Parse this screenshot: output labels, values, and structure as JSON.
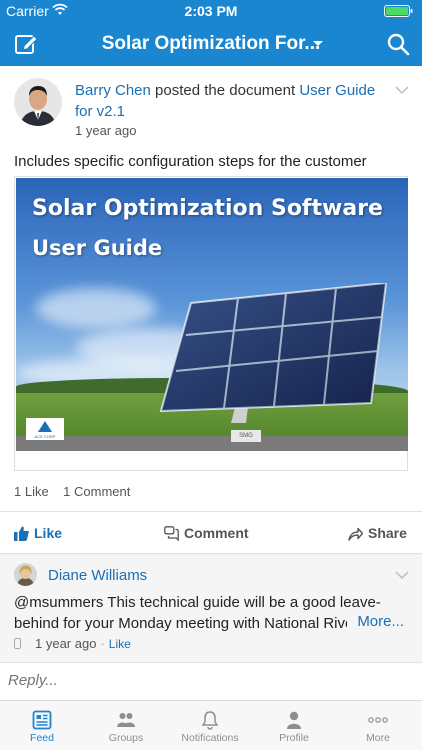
{
  "status_bar": {
    "carrier": "Carrier",
    "time": "2:03 PM"
  },
  "nav": {
    "title": "Solar Optimization For..."
  },
  "post": {
    "author": "Barry Chen",
    "action": "posted the document",
    "document": "User Guide for v2.1",
    "time": "1 year ago",
    "body": "Includes specific configuration steps for the customer",
    "doc_title_line1": "Solar Optimization Software",
    "doc_title_line2": "User Guide",
    "doc_logo": "ACE CORP",
    "doc_sign": "SMG",
    "likes": "1 Like",
    "comments": "1 Comment"
  },
  "actions": {
    "like": "Like",
    "comment": "Comment",
    "share": "Share"
  },
  "comment": {
    "author": "Diane Williams",
    "text": "@msummers This technical guide will be a good leave-behind for your Monday meeting with National Rivera.",
    "more": "More...",
    "time": "1 year ago",
    "like": "Like"
  },
  "reply": {
    "placeholder": "Reply..."
  },
  "tabs": [
    {
      "label": "Feed",
      "icon": "feed-icon"
    },
    {
      "label": "Groups",
      "icon": "groups-icon"
    },
    {
      "label": "Notifications",
      "icon": "bell-icon"
    },
    {
      "label": "Profile",
      "icon": "profile-icon"
    },
    {
      "label": "More",
      "icon": "more-icon"
    }
  ],
  "colors": {
    "brand": "#1a86d0",
    "link": "#1a6fb5",
    "battery": "#4cd964"
  }
}
